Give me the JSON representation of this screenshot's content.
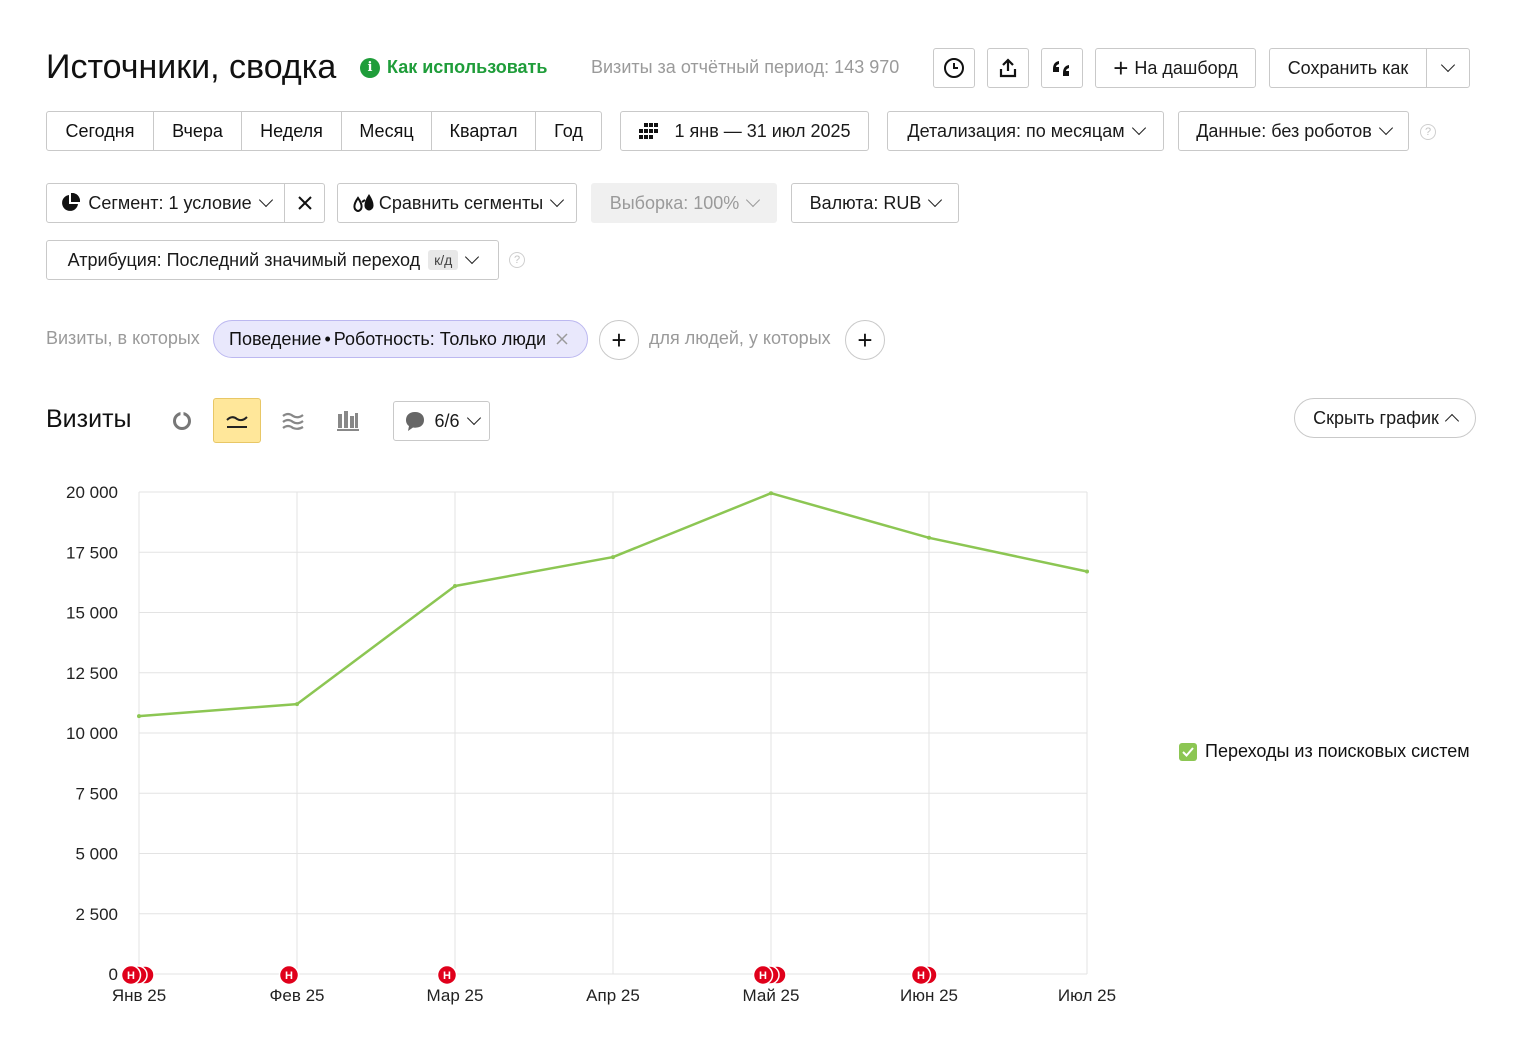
{
  "header": {
    "title": "Источники, сводка",
    "howto_label": "Как использовать",
    "visits_summary": "Визиты за отчётный период: 143 970",
    "dashboard_label": "На дашборд",
    "save_as_label": "Сохранить как"
  },
  "periods": [
    "Сегодня",
    "Вчера",
    "Неделя",
    "Месяц",
    "Квартал",
    "Год"
  ],
  "date_range": "1 янв — 31 июл 2025",
  "detail_label": "Детализация: по месяцам",
  "data_label": "Данные: без роботов",
  "segment": {
    "label": "Сегмент: 1 условие",
    "compare_label": "Сравнить сегменты",
    "sample_label": "Выборка: 100%",
    "currency_label": "Валюта: RUB",
    "attribution_label": "Атрибуция: Последний значимый переход",
    "attribution_badge": "к/д"
  },
  "filter": {
    "prefix": "Визиты, в которых",
    "chip_group": "Поведение",
    "chip_value": "Роботность: Только люди",
    "people_label": "для людей, у которых"
  },
  "chart_header": {
    "title": "Визиты",
    "annotations_count": "6/6",
    "hide_chart_label": "Скрыть график"
  },
  "colors": {
    "line": "#8cc653",
    "accent": "#ffe79a",
    "chip_bg": "#e9e8fc",
    "marker": "#e0001b"
  },
  "chart_data": {
    "type": "line",
    "categories": [
      "Янв 25",
      "Фев 25",
      "Мар 25",
      "Апр 25",
      "Май 25",
      "Июн 25",
      "Июл 25"
    ],
    "series": [
      {
        "name": "Переходы из поисковых систем",
        "values": [
          10700,
          11200,
          16100,
          17300,
          19950,
          18100,
          16700
        ]
      }
    ],
    "ylim": [
      0,
      20000
    ],
    "yticks": [
      0,
      2500,
      5000,
      7500,
      10000,
      12500,
      15000,
      17500,
      20000
    ],
    "ytick_labels": [
      "0",
      "2 500",
      "5 000",
      "7 500",
      "10 000",
      "12 500",
      "15 000",
      "17 500",
      "20 000"
    ],
    "grid": true,
    "legend": "right",
    "annotation_markers": [
      {
        "category": "Янв 25",
        "count": 3,
        "letter": "Н"
      },
      {
        "category": "Фев 25",
        "count": 1,
        "letter": "Н"
      },
      {
        "category": "Мар 25",
        "count": 1,
        "letter": "Н"
      },
      {
        "category": "Май 25",
        "count": 3,
        "letter": "Н"
      },
      {
        "category": "Июн 25",
        "count": 2,
        "letter": "Н"
      }
    ]
  }
}
